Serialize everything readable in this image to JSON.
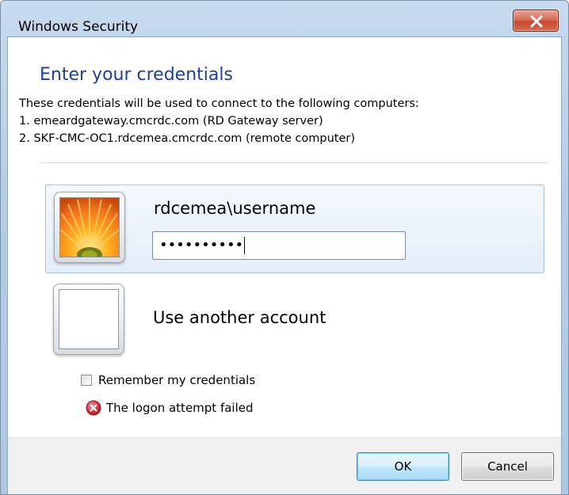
{
  "window": {
    "title": "Windows Security"
  },
  "content": {
    "heading": "Enter your credentials",
    "description_lines": [
      "These credentials will be used to connect to the following computers:",
      "1. emeardgateway.cmcrdc.com (RD Gateway server)",
      "2. SKF-CMC-OC1.rdcemea.cmcrdc.com (remote computer)"
    ]
  },
  "selected_account": {
    "username": "rdcemea\\username",
    "password_mask": "••••••••••",
    "avatar": "orange-flower-image"
  },
  "other_account": {
    "label": "Use another account",
    "avatar": "blank-user-tile"
  },
  "options": {
    "remember_label": "Remember my credentials",
    "remember_checked": false
  },
  "status": {
    "error_text": "The logon attempt failed",
    "error_icon": "error-x-icon",
    "error_color": "#d9333f"
  },
  "buttons": {
    "ok_label": "OK",
    "cancel_label": "Cancel"
  },
  "colors": {
    "heading": "#1f3d99",
    "selected_tile_bg": "#e4eef9",
    "close_button": "#c74a2f"
  }
}
